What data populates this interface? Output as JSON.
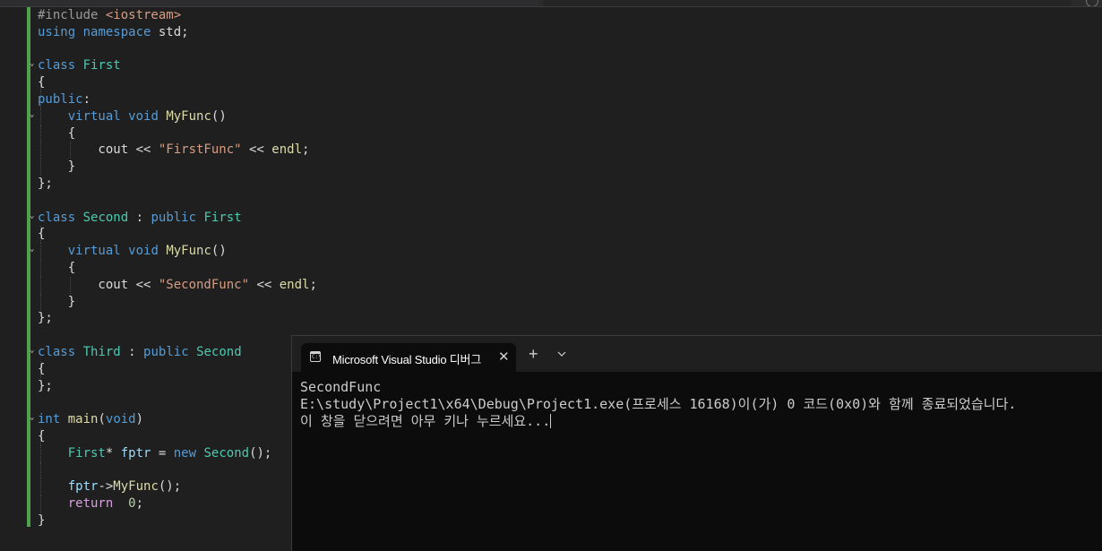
{
  "editor": {
    "lines": [
      [
        {
          "t": "#include ",
          "c": "pp"
        },
        {
          "t": "<iostream>",
          "c": "st"
        }
      ],
      [
        {
          "t": "using",
          "c": "kw"
        },
        {
          "t": " ",
          "c": "tx"
        },
        {
          "t": "namespace",
          "c": "kw"
        },
        {
          "t": " std;",
          "c": "tx"
        }
      ],
      [],
      [
        {
          "t": "class",
          "c": "kw"
        },
        {
          "t": " ",
          "c": "tx"
        },
        {
          "t": "First",
          "c": "ty"
        }
      ],
      [
        {
          "t": "{",
          "c": "tx"
        }
      ],
      [
        {
          "t": "public",
          "c": "kw"
        },
        {
          "t": ":",
          "c": "tx"
        }
      ],
      [
        {
          "t": "    ",
          "c": "tx"
        },
        {
          "t": "virtual",
          "c": "kw"
        },
        {
          "t": " ",
          "c": "tx"
        },
        {
          "t": "void",
          "c": "kw"
        },
        {
          "t": " ",
          "c": "tx"
        },
        {
          "t": "MyFunc",
          "c": "fn"
        },
        {
          "t": "()",
          "c": "tx"
        }
      ],
      [
        {
          "t": "    {",
          "c": "tx"
        }
      ],
      [
        {
          "t": "        cout << ",
          "c": "tx"
        },
        {
          "t": "\"FirstFunc\"",
          "c": "st"
        },
        {
          "t": " << ",
          "c": "tx"
        },
        {
          "t": "endl",
          "c": "fn"
        },
        {
          "t": ";",
          "c": "tx"
        }
      ],
      [
        {
          "t": "    }",
          "c": "tx"
        }
      ],
      [
        {
          "t": "};",
          "c": "tx"
        }
      ],
      [],
      [
        {
          "t": "class",
          "c": "kw"
        },
        {
          "t": " ",
          "c": "tx"
        },
        {
          "t": "Second",
          "c": "ty"
        },
        {
          "t": " : ",
          "c": "tx"
        },
        {
          "t": "public",
          "c": "kw"
        },
        {
          "t": " ",
          "c": "tx"
        },
        {
          "t": "First",
          "c": "ty"
        }
      ],
      [
        {
          "t": "{",
          "c": "tx"
        }
      ],
      [
        {
          "t": "    ",
          "c": "tx"
        },
        {
          "t": "virtual",
          "c": "kw"
        },
        {
          "t": " ",
          "c": "tx"
        },
        {
          "t": "void",
          "c": "kw"
        },
        {
          "t": " ",
          "c": "tx"
        },
        {
          "t": "MyFunc",
          "c": "fn"
        },
        {
          "t": "()",
          "c": "tx"
        }
      ],
      [
        {
          "t": "    {",
          "c": "tx"
        }
      ],
      [
        {
          "t": "        cout << ",
          "c": "tx"
        },
        {
          "t": "\"SecondFunc\"",
          "c": "st"
        },
        {
          "t": " << ",
          "c": "tx"
        },
        {
          "t": "endl",
          "c": "fn"
        },
        {
          "t": ";",
          "c": "tx"
        }
      ],
      [
        {
          "t": "    }",
          "c": "tx"
        }
      ],
      [
        {
          "t": "};",
          "c": "tx"
        }
      ],
      [],
      [
        {
          "t": "class",
          "c": "kw"
        },
        {
          "t": " ",
          "c": "tx"
        },
        {
          "t": "Third",
          "c": "ty"
        },
        {
          "t": " : ",
          "c": "tx"
        },
        {
          "t": "public",
          "c": "kw"
        },
        {
          "t": " ",
          "c": "tx"
        },
        {
          "t": "Second",
          "c": "ty"
        }
      ],
      [
        {
          "t": "{",
          "c": "tx"
        }
      ],
      [
        {
          "t": "};",
          "c": "tx"
        }
      ],
      [],
      [
        {
          "t": "int",
          "c": "kw"
        },
        {
          "t": " ",
          "c": "tx"
        },
        {
          "t": "main",
          "c": "fn"
        },
        {
          "t": "(",
          "c": "tx"
        },
        {
          "t": "void",
          "c": "kw"
        },
        {
          "t": ")",
          "c": "tx"
        }
      ],
      [
        {
          "t": "{",
          "c": "tx"
        }
      ],
      [
        {
          "t": "    ",
          "c": "tx"
        },
        {
          "t": "First",
          "c": "ty"
        },
        {
          "t": "* ",
          "c": "tx"
        },
        {
          "t": "fptr",
          "c": "va"
        },
        {
          "t": " = ",
          "c": "tx"
        },
        {
          "t": "new",
          "c": "kw"
        },
        {
          "t": " ",
          "c": "tx"
        },
        {
          "t": "Second",
          "c": "ty"
        },
        {
          "t": "();",
          "c": "tx"
        }
      ],
      [],
      [
        {
          "t": "    ",
          "c": "tx"
        },
        {
          "t": "fptr",
          "c": "va"
        },
        {
          "t": "->",
          "c": "tx"
        },
        {
          "t": "MyFunc",
          "c": "fn"
        },
        {
          "t": "();",
          "c": "tx"
        }
      ],
      [
        {
          "t": "    ",
          "c": "tx"
        },
        {
          "t": "return",
          "c": "kw2"
        },
        {
          "t": "  ",
          "c": "tx"
        },
        {
          "t": "0",
          "c": "nu"
        },
        {
          "t": ";",
          "c": "tx"
        }
      ],
      [
        {
          "t": "}",
          "c": "tx"
        }
      ]
    ]
  },
  "console": {
    "tab_title": "Microsoft Visual Studio 디버그",
    "close_glyph": "✕",
    "new_tab_glyph": "+",
    "output_line1": "SecondFunc",
    "output_line2": "",
    "output_line3": "E:\\study\\Project1\\x64\\Debug\\Project1.exe(프로세스 16168)이(가) 0 코드(0x0)와 함께 종료되었습니다.",
    "output_line4": "이 창을 닫으려면 아무 키나 누르세요..."
  },
  "colors": {
    "editor_bg": "#1f1f1f",
    "console_bg": "#0c0c0c",
    "change_bar": "#4fa24b"
  }
}
